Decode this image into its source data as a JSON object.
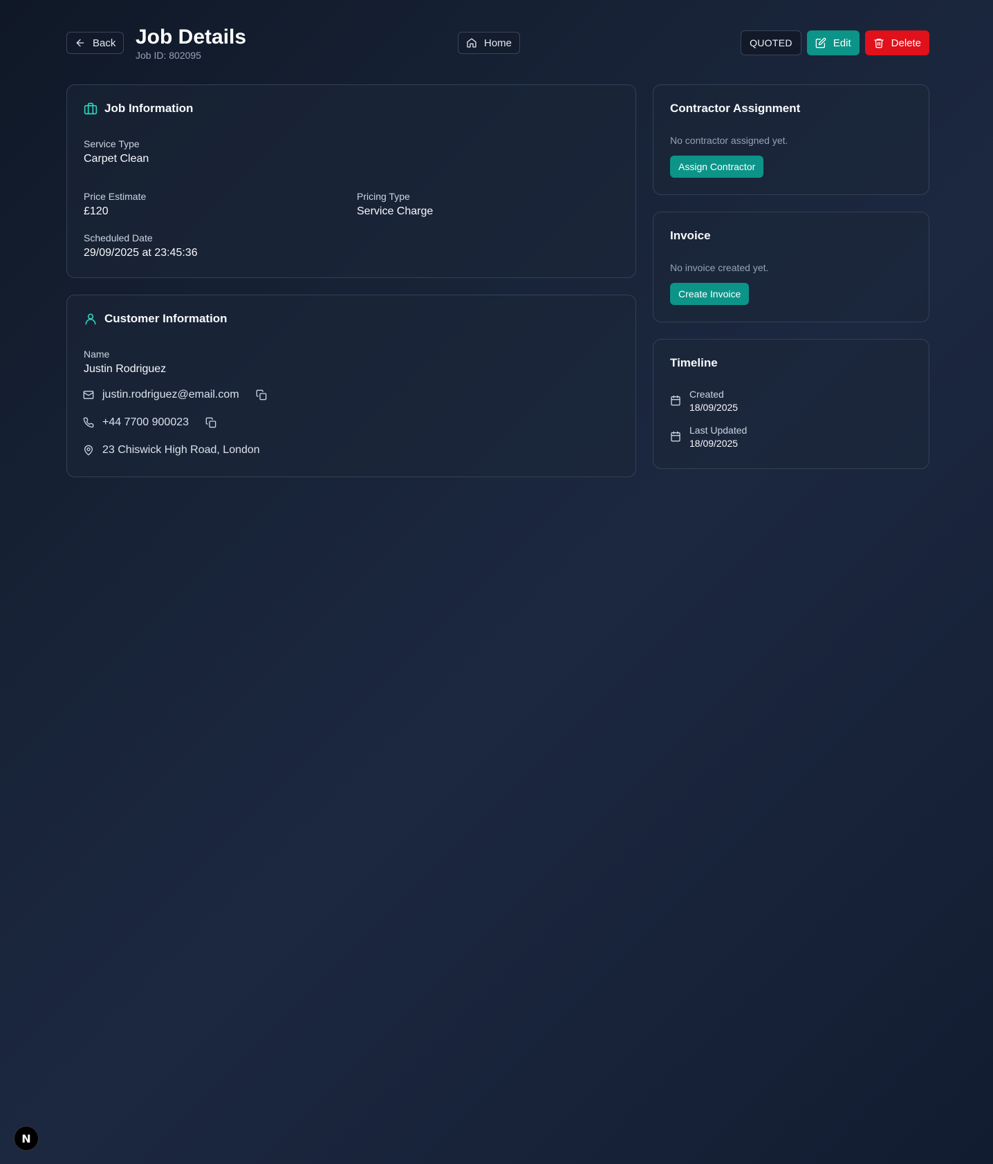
{
  "header": {
    "back_label": "Back",
    "title": "Job Details",
    "job_id": "Job ID: 802095",
    "home_label": "Home",
    "status": "QUOTED",
    "edit_label": "Edit",
    "delete_label": "Delete"
  },
  "job_info": {
    "title": "Job Information",
    "service_type_label": "Service Type",
    "service_type": "Carpet Clean",
    "price_label": "Price Estimate",
    "price": "£120",
    "pricing_type_label": "Pricing Type",
    "pricing_type": "Service Charge",
    "scheduled_label": "Scheduled Date",
    "scheduled": "29/09/2025 at 23:45:36"
  },
  "customer": {
    "title": "Customer Information",
    "name_label": "Name",
    "name": "Justin Rodriguez",
    "email": "justin.rodriguez@email.com",
    "phone": "+44 7700 900023",
    "address": "23 Chiswick High Road, London"
  },
  "contractor": {
    "title": "Contractor Assignment",
    "empty": "No contractor assigned yet.",
    "button": "Assign Contractor"
  },
  "invoice": {
    "title": "Invoice",
    "empty": "No invoice created yet.",
    "button": "Create Invoice"
  },
  "timeline": {
    "title": "Timeline",
    "created_label": "Created",
    "created": "18/09/2025",
    "updated_label": "Last Updated",
    "updated": "18/09/2025"
  },
  "dev_badge": "N",
  "colors": {
    "accent": "#0c9488",
    "danger": "#e0111b",
    "icon_accent": "#2dd4bf"
  }
}
